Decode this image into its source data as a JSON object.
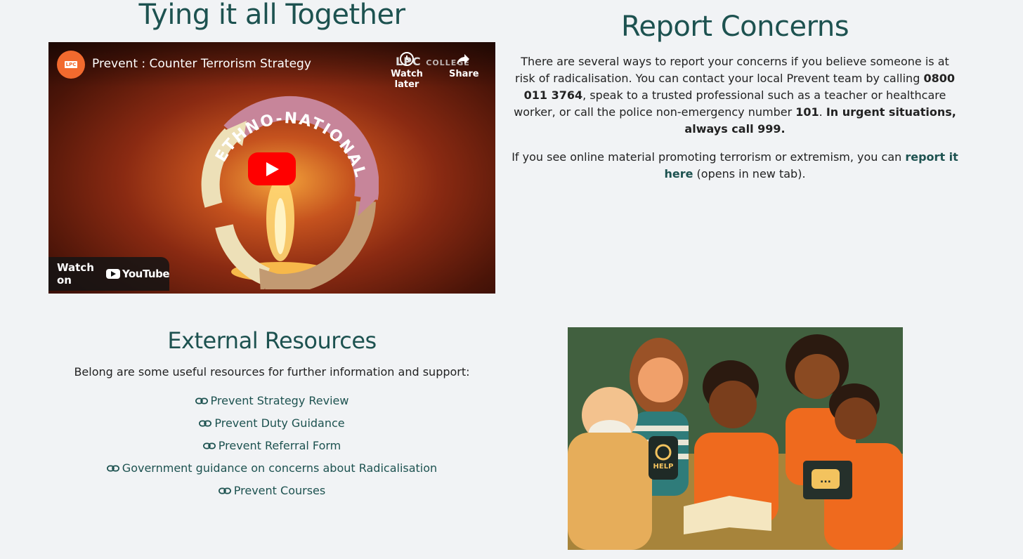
{
  "tying": {
    "title": "Tying it all Together"
  },
  "video": {
    "channel_logo_text": "LPC",
    "title": "Prevent : Counter Terrorism Strategy",
    "watch_later": "Watch later",
    "share": "Share",
    "college_mark": "LPC",
    "college_word": "COLLEGE",
    "cycle_label": "ETHNO-NATIONAL",
    "watch_on": "Watch on",
    "youtube": "YouTube"
  },
  "report": {
    "title": "Report Concerns",
    "p1_a": "There are several ways to report your concerns if you believe someone is at risk of radicalisation. You can contact your local Prevent team by calling ",
    "phone": "0800 011 3764",
    "p1_b": ", speak to a trusted professional such as a teacher or healthcare worker, or call the police non-emergency number ",
    "non_emergency": "101",
    "p1_c": ". ",
    "urgent": "In urgent situations, always call 999.",
    "p2_a": "If you see online material promoting terrorism or extremism, you can ",
    "p2_link": "report it here",
    "p2_b": " (opens in new tab)."
  },
  "external": {
    "title": "External Resources",
    "intro": "Belong are some useful resources for further information and support:",
    "links": [
      "Prevent Strategy Review",
      "Prevent Duty Guidance",
      "Prevent Referral Form",
      "Government guidance on concerns about Radicalisation",
      "Prevent Courses"
    ]
  },
  "illustration": {
    "phone_text": "HELP",
    "laptop_text": "..."
  },
  "colors": {
    "teal": "#1d5250",
    "background": "#f1f3f5",
    "youtube_red": "#ff0000",
    "orange": "#f26a2e"
  }
}
